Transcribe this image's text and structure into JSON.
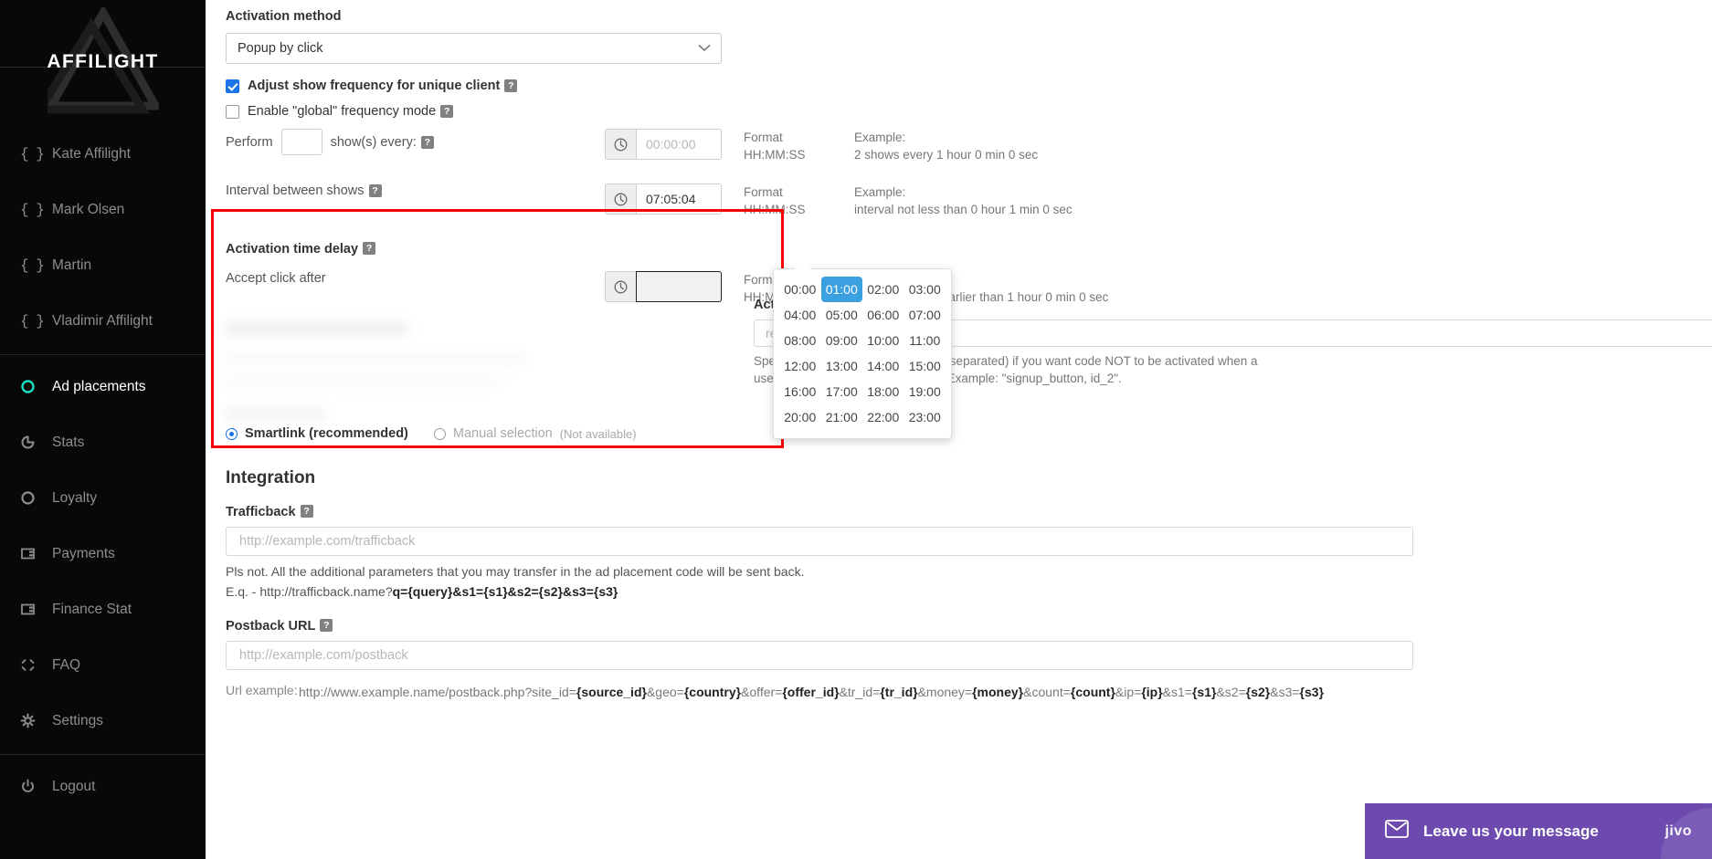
{
  "brand": {
    "name": "AFFILIGHT"
  },
  "sidebar": {
    "accounts": [
      {
        "label": "Kate Affilight",
        "icon": "braces-icon"
      },
      {
        "label": "Mark Olsen",
        "icon": "braces-icon"
      },
      {
        "label": "Martin",
        "icon": "braces-icon"
      },
      {
        "label": "Vladimir Affilight",
        "icon": "braces-icon"
      }
    ],
    "nav": [
      {
        "label": "Ad placements",
        "icon": "circle-icon",
        "active": true
      },
      {
        "label": "Stats",
        "icon": "pie-chart-icon",
        "active": false
      },
      {
        "label": "Loyalty",
        "icon": "circle-icon",
        "active": false
      },
      {
        "label": "Payments",
        "icon": "card-icon",
        "active": false
      },
      {
        "label": "Finance Stat",
        "icon": "card-icon",
        "active": false
      },
      {
        "label": "FAQ",
        "icon": "diamond-icon",
        "active": false
      },
      {
        "label": "Settings",
        "icon": "gear-icon",
        "active": false
      }
    ],
    "logout": {
      "label": "Logout",
      "icon": "power-icon"
    }
  },
  "form": {
    "activation_method": {
      "label": "Activation method",
      "value": "Popup by click"
    },
    "adjust_frequency": {
      "label": "Adjust show frequency for unique client",
      "checked": true,
      "help": "?"
    },
    "global_mode": {
      "label": "Enable \"global\" frequency mode",
      "checked": false,
      "help": "?"
    },
    "perform_row": {
      "prefix": "Perform",
      "count_value": "",
      "suffix": "show(s) every:",
      "help": "?",
      "time_placeholder": "00:00:00",
      "time_value": "",
      "format_label": "Format",
      "format_value": "HH:MM:SS",
      "example_label": "Example:",
      "example_value": "2 shows every 1 hour 0 min 0 sec"
    },
    "interval_row": {
      "label": "Interval between shows",
      "help": "?",
      "time_value": "07:05:04",
      "format_label": "Format",
      "format_value": "HH:MM:SS",
      "example_label": "Example:",
      "example_value": "interval not less than 0 hour 1 min 0 sec"
    },
    "activation_delay": {
      "title": "Activation time delay",
      "help": "?",
      "label": "Accept click after",
      "time_value": "",
      "format_label": "Format",
      "format_value": "HH:MM:SS",
      "example_label": "Example:",
      "example_value": "accept click not earlier than 1 hour 0 min 0 sec"
    },
    "time_picker": {
      "selected": "01:00",
      "options": [
        "00:00",
        "01:00",
        "02:00",
        "03:00",
        "04:00",
        "05:00",
        "06:00",
        "07:00",
        "08:00",
        "09:00",
        "10:00",
        "11:00",
        "12:00",
        "13:00",
        "14:00",
        "15:00",
        "16:00",
        "17:00",
        "18:00",
        "19:00",
        "20:00",
        "21:00",
        "22:00",
        "23:00"
      ]
    },
    "activated_by_click": {
      "label": "Activated by click on",
      "help": "?",
      "placeholder": "required",
      "note_line1": "Specify HTML id attributes (comma-separated) if you want code NOT to be activated when a",
      "note_line2": "user clicks on a particular element. Example: \"signup_button, id_2\"."
    },
    "link_mode": {
      "smartlink_label": "Smartlink (recommended)",
      "smartlink_selected": true,
      "manual_label": "Manual selection",
      "manual_selected": false,
      "manual_note": "(Not available)"
    }
  },
  "integration": {
    "title": "Integration",
    "trafficback": {
      "label": "Trafficback",
      "help": "?",
      "placeholder": "http://example.com/trafficback",
      "note": "Pls not. All the additional parameters that you may transfer in the ad placement code will be sent back.",
      "example_prefix": "E.q. - http://trafficback.name?",
      "example_params": "q={query}&s1={s1}&s2={s2}&s3={s3}"
    },
    "postback": {
      "label": "Postback URL",
      "help": "?",
      "placeholder": "http://example.com/postback",
      "url_example_label": "Url example:",
      "url_example_plain_1": "http://www.example.name/postback.php?site_id=",
      "url_example_b1": "{source_id}",
      "url_example_plain_2": "&geo=",
      "url_example_b2": "{country}",
      "url_example_plain_3": "&offer=",
      "url_example_b3": "{offer_id}",
      "url_example_plain_4": "&tr_id=",
      "url_example_b4": "{tr_id}",
      "url_example_plain_5": "&money=",
      "url_example_b5": "{money}",
      "url_example_plain_6": "&count=",
      "url_example_b6": "{count}",
      "url_example_plain_7": "&ip=",
      "url_example_b7": "{ip}",
      "url_example_plain_8": "&s1=",
      "url_example_b8": "{s1}",
      "url_example_plain_9": "&s2=",
      "url_example_b9": "{s2}",
      "url_example_plain_10": "&s3=",
      "url_example_b10": "{s3}"
    }
  },
  "chat_widget": {
    "text": "Leave us your message",
    "brand": "jivo"
  },
  "colors": {
    "sidebar_bg": "#080808",
    "accent": "#1ddbc0",
    "checkbox_blue": "#1a73e8",
    "picker_selected": "#3aa0e0",
    "highlight_red": "#ff0000",
    "jivo_purple": "#6d4aae"
  }
}
